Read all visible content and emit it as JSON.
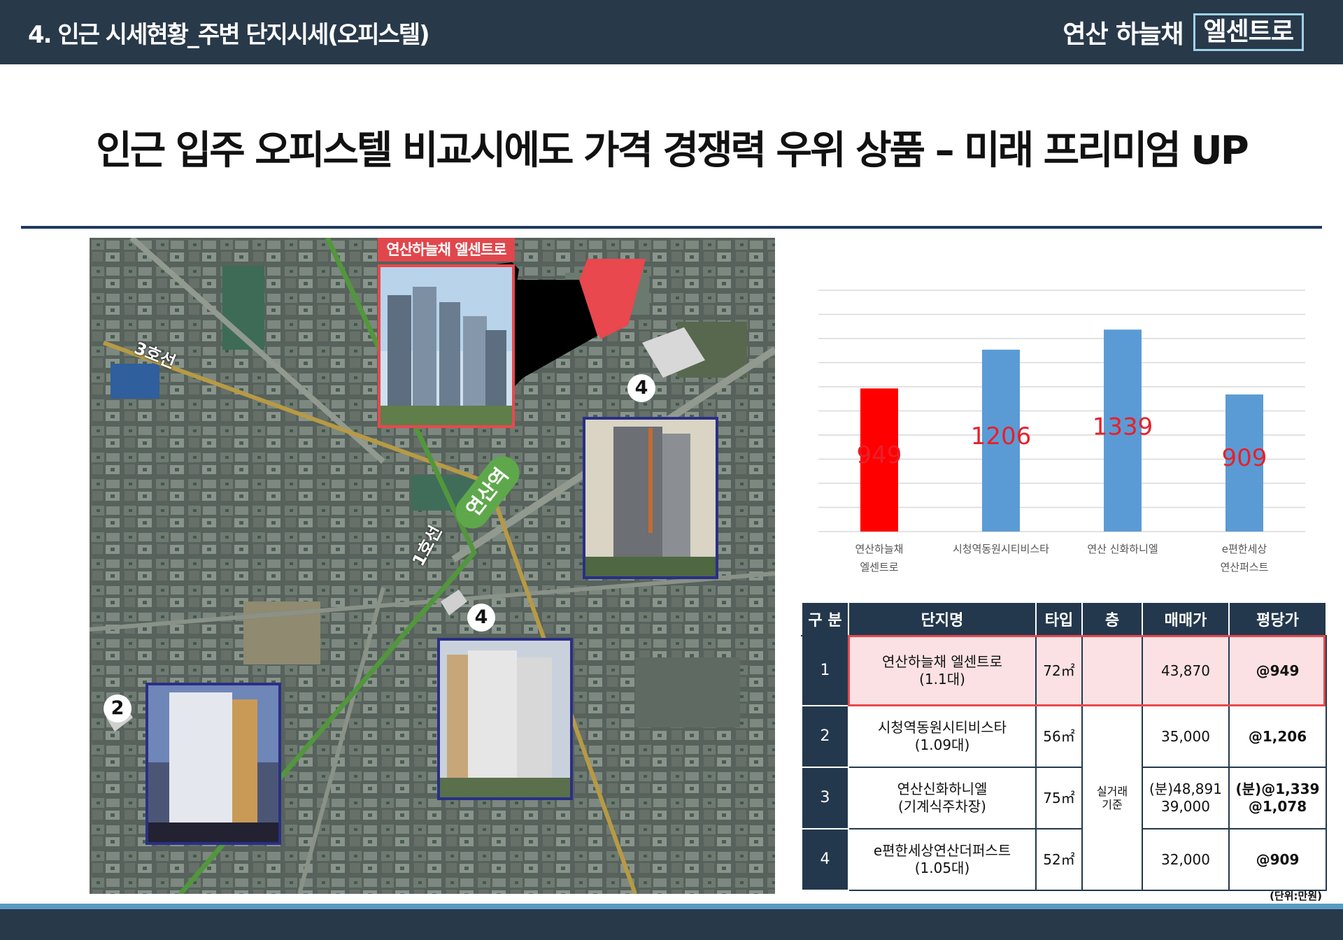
{
  "header": {
    "section_title": "4. 인근 시세현황_주변 단지시세(오피스텔)",
    "brand_name": "연산 하늘채",
    "brand_sub": "엘센트로"
  },
  "headline": "인근 입주 오피스텔 비교시에도 가격 경쟁력 우위 상품 – 미래 프리미엄  UP",
  "map": {
    "site_label": "연산하늘채 엘센트로",
    "line3_label": "3호선",
    "line1_label": "1호선",
    "station_label": "연산역",
    "markers": [
      "4",
      "4",
      "2"
    ]
  },
  "colors": {
    "header_bg": "#28394a",
    "accent_red": "#ff0000",
    "bar_blue": "#5b9bd5",
    "table_header": "#24384d",
    "highlight_row": "#fbe1e3"
  },
  "chart_data": {
    "type": "bar",
    "categories": [
      "연산하늘채\n엘센트로",
      "시청역동원시티비스타",
      "연산 신화하니엘",
      "e편한세상\n연산퍼스트"
    ],
    "values": [
      949,
      1206,
      1339,
      909
    ],
    "bar_colors": [
      "#ff0000",
      "#5b9bd5",
      "#5b9bd5",
      "#5b9bd5"
    ],
    "data_labels": [
      "949",
      "1206",
      "1339",
      "909"
    ],
    "ylim": [
      0,
      1600
    ],
    "grid": true,
    "title": "",
    "xlabel": "",
    "ylabel": ""
  },
  "table": {
    "headers": [
      "구 분",
      "단지명",
      "타입",
      "층",
      "매매가",
      "평당가"
    ],
    "rows": [
      {
        "no": "1",
        "name1": "연산하늘채 엘센트로",
        "name2": "(1.1대)",
        "type": "72㎡",
        "price1": "43,870",
        "price2": "",
        "pyeong1": "@949",
        "pyeong2": ""
      },
      {
        "no": "2",
        "name1": "시청역동원시티비스타",
        "name2": "(1.09대)",
        "type": "56㎡",
        "price1": "35,000",
        "price2": "",
        "pyeong1": "@1,206",
        "pyeong2": ""
      },
      {
        "no": "3",
        "name1": "연산신화하니엘",
        "name2": "(기계식주차장)",
        "type": "75㎡",
        "price1": "(분)48,891",
        "price2": "39,000",
        "pyeong1": "(분)@1,339",
        "pyeong2": "@1,078"
      },
      {
        "no": "4",
        "name1": "e편한세상연산더퍼스트",
        "name2": "(1.05대)",
        "type": "52㎡",
        "price1": "32,000",
        "price2": "",
        "pyeong1": "@909",
        "pyeong2": ""
      }
    ],
    "floor_note_1": "실거래",
    "floor_note_2": "기준",
    "unit_note": "(단위:만원)"
  }
}
